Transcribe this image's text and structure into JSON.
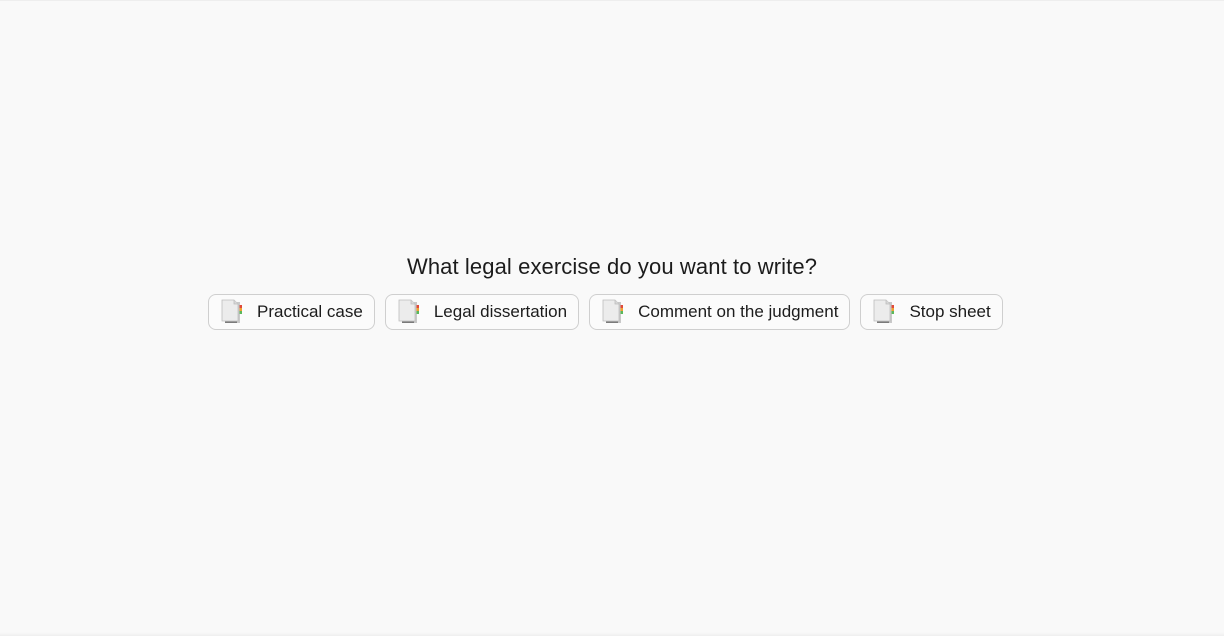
{
  "prompt": {
    "question": "What legal exercise do you want to write?"
  },
  "options": [
    {
      "label": "Practical case",
      "icon": "document-icon"
    },
    {
      "label": "Legal dissertation",
      "icon": "document-icon"
    },
    {
      "label": "Comment on the judgment",
      "icon": "document-icon"
    },
    {
      "label": "Stop sheet",
      "icon": "document-icon"
    }
  ],
  "colors": {
    "background": "#f9f9f9",
    "button_border": "#cfcfcf",
    "text": "#1c1c1c",
    "icon_accent_green": "#5bb85b",
    "icon_accent_orange": "#f0a030",
    "icon_accent_red": "#e04a3a"
  }
}
